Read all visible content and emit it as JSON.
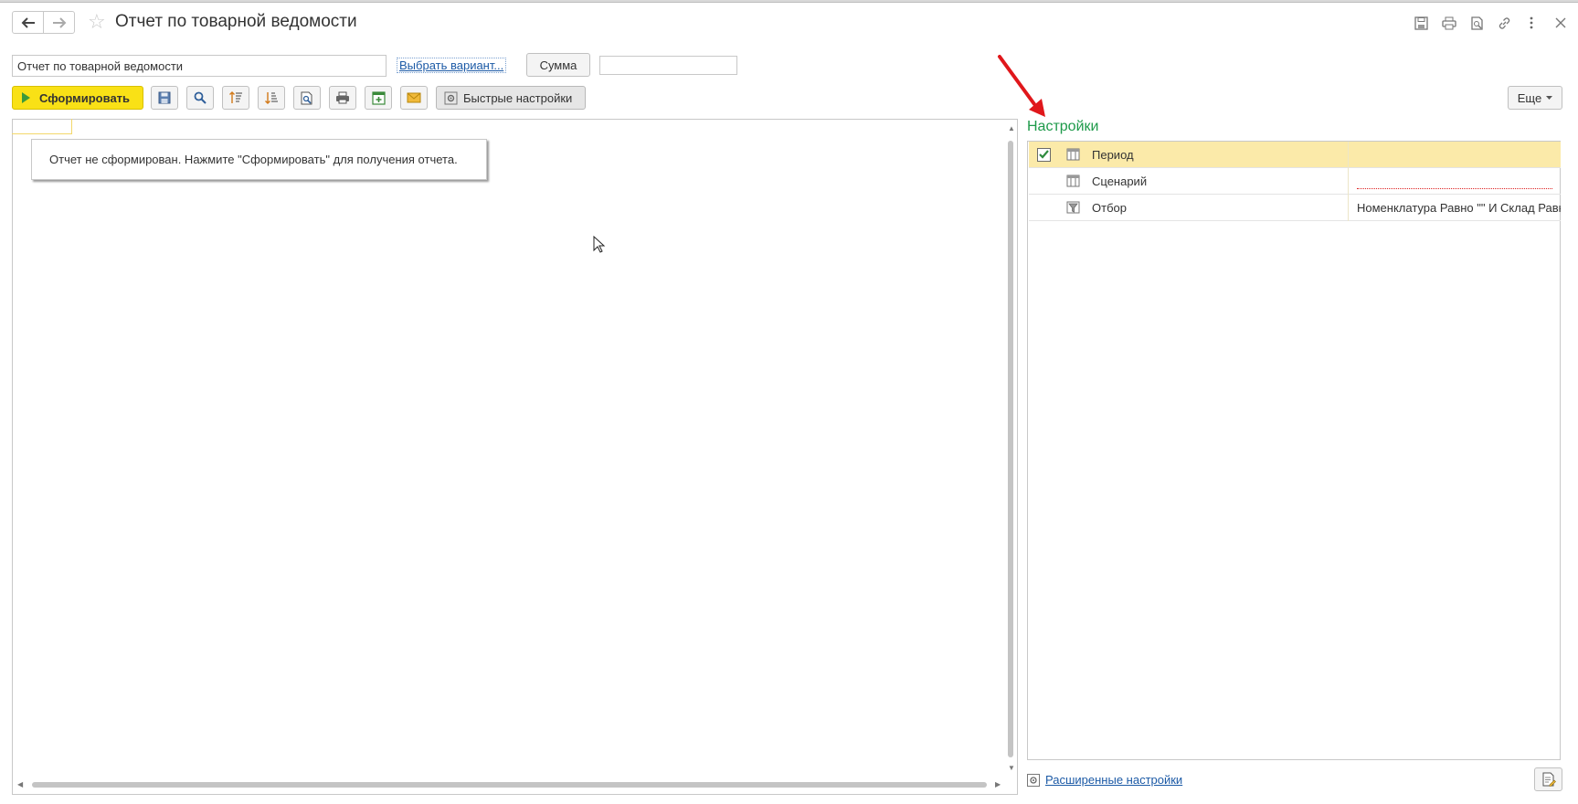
{
  "window": {
    "title": "Отчет по товарной ведомости"
  },
  "header": {
    "icons": [
      "back-arrow-icon",
      "forward-arrow-icon",
      "favorite-star-icon",
      "save-icon",
      "print-icon",
      "preview-icon",
      "link-icon",
      "more-vertical-icon",
      "close-icon"
    ]
  },
  "params": {
    "variant_value": "Отчет по товарной ведомости",
    "choose_variant_label": "Выбрать вариант...",
    "sum_label": "Сумма",
    "sum_value": ""
  },
  "toolbar": {
    "generate_label": "Сформировать",
    "quick_settings_label": "Быстрые настройки",
    "more_label": "Еще",
    "icons": [
      "save-icon",
      "find-icon",
      "sort-asc-icon",
      "sort-desc-icon",
      "preview-icon",
      "print-icon",
      "new-window-icon",
      "email-icon"
    ]
  },
  "report": {
    "message": "Отчет не сформирован. Нажмите \"Сформировать\" для получения отчета."
  },
  "settings": {
    "title": "Настройки",
    "rows": [
      {
        "name": "Период",
        "value": "",
        "checked": true
      },
      {
        "name": "Сценарий",
        "value": "",
        "checked": false
      },
      {
        "name": "Отбор",
        "value": "Номенклатура Равно \"\" И Склад Равно \"\"",
        "checked": false
      }
    ],
    "advanced_link": "Расширенные настройки"
  },
  "colors": {
    "accent_yellow": "#f9e116",
    "settings_title": "#1e9a4a",
    "link": "#1c5aa6",
    "selected_row": "#fbeaa9",
    "arrow": "#e0171b"
  }
}
